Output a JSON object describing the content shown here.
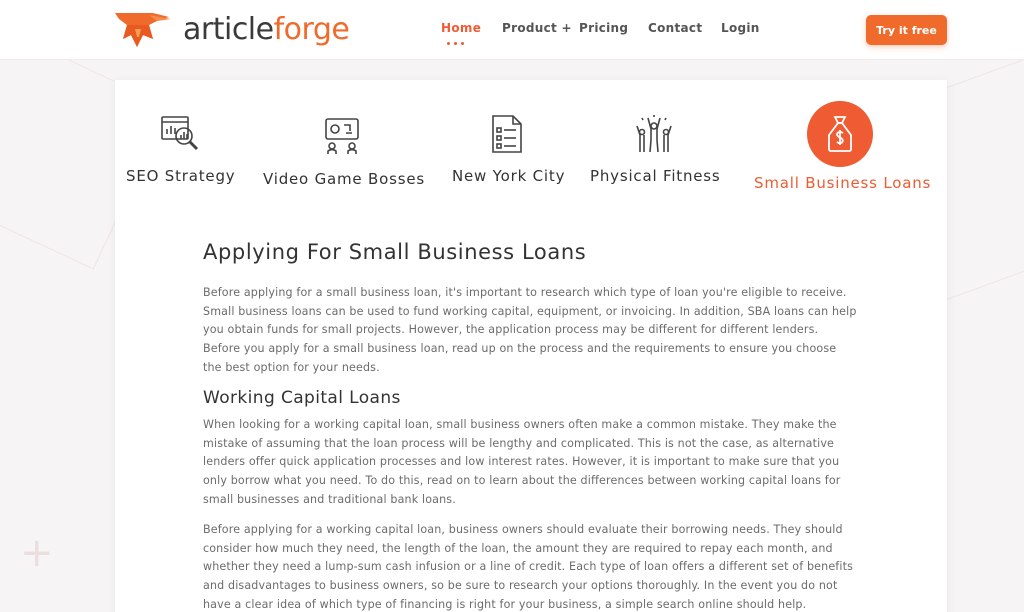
{
  "header": {
    "logo": {
      "part1": "article",
      "part2": "forge"
    },
    "nav": [
      {
        "label": "Home",
        "active": true
      },
      {
        "label": "Product +",
        "active": false
      },
      {
        "label": "Pricing",
        "active": false
      },
      {
        "label": "Contact",
        "active": false
      },
      {
        "label": "Login",
        "active": false
      }
    ],
    "cta_label": "Try it free"
  },
  "tabs": [
    {
      "label": "SEO Strategy",
      "icon": "seo-analytics-icon"
    },
    {
      "label": "Video Game Bosses",
      "icon": "game-board-icon"
    },
    {
      "label": "New York City",
      "icon": "checklist-document-icon"
    },
    {
      "label": "Physical Fitness",
      "icon": "cheering-people-icon"
    },
    {
      "label": "Small Business Loans",
      "icon": "money-bag-dollar-icon",
      "active": true
    }
  ],
  "article": {
    "title": "Applying For Small Business Loans",
    "intro": "Before applying for a small business loan, it's important to research which type of loan you're eligible to receive. Small business loans can be used to fund working capital, equipment, or invoicing. In addition, SBA loans can help you obtain funds for small projects. However, the application process may be different for different lenders. Before you apply for a small business loan, read up on the process and the requirements to ensure you choose the best option for your needs.",
    "section_title": "Working Capital Loans",
    "para1": "When looking for a working capital loan, small business owners often make a common mistake. They make the mistake of assuming that the loan process will be lengthy and complicated. This is not the case, as alternative lenders offer quick application processes and low interest rates. However, it is important to make sure that you only borrow what you need. To do this, read on to learn about the differences between working capital loans for small businesses and traditional bank loans.",
    "para2": "Before applying for a working capital loan, business owners should evaluate their borrowing needs. They should consider how much they need, the length of the loan, the amount they are required to repay each month, and whether they need a lump-sum cash infusion or a line of credit. Each type of loan offers a different set of benefits and disadvantages to business owners, so be sure to research your options thoroughly. In the event you do not have a clear idea of which type of financing is right for your business, a simple search online should help."
  },
  "colors": {
    "accent": "#ef5b32",
    "cta": "#f06b2b",
    "text": "#333333",
    "body_text": "#6b6b6b"
  }
}
